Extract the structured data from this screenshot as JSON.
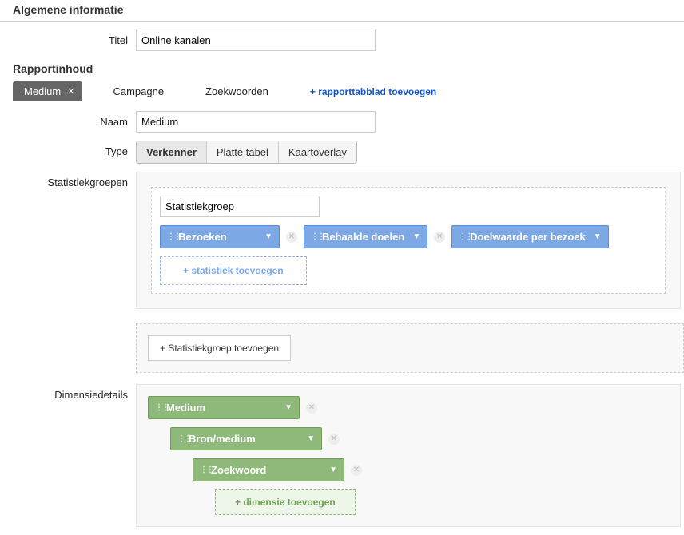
{
  "general": {
    "section_title": "Algemene informatie",
    "title_label": "Titel",
    "title_value": "Online kanalen"
  },
  "content": {
    "section_title": "Rapportinhoud",
    "tabs": {
      "active": "Medium",
      "items": [
        "Campagne",
        "Zoekwoorden"
      ],
      "add_label": "+ rapporttabblad toevoegen"
    },
    "name_label": "Naam",
    "name_value": "Medium",
    "type_label": "Type",
    "type_options": [
      "Verkenner",
      "Platte tabel",
      "Kaartoverlay"
    ],
    "stat_groups_label": "Statistiekgroepen",
    "stat_group_name": "Statistiekgroep",
    "stat_pills": [
      "Bezoeken",
      "Behaalde doelen",
      "Doelwaarde per bezoek"
    ],
    "add_stat": "+ statistiek toevoegen",
    "add_stat_group": "+ Statistiekgroep toevoegen",
    "dim_label": "Dimensiedetails",
    "dim_levels": [
      "Medium",
      "Bron/medium",
      "Zoekwoord"
    ],
    "add_dim": "+ dimensie toevoegen"
  }
}
